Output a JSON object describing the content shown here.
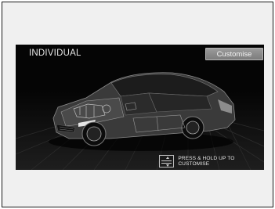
{
  "screen": {
    "mode_label": "INDIVIDUAL",
    "customise_button": "Customise",
    "hint_text": "PRESS & HOLD UP TO CUSTOMISE",
    "hint_icon": "up-down-selector-icon",
    "vehicle": "car-illustration"
  }
}
